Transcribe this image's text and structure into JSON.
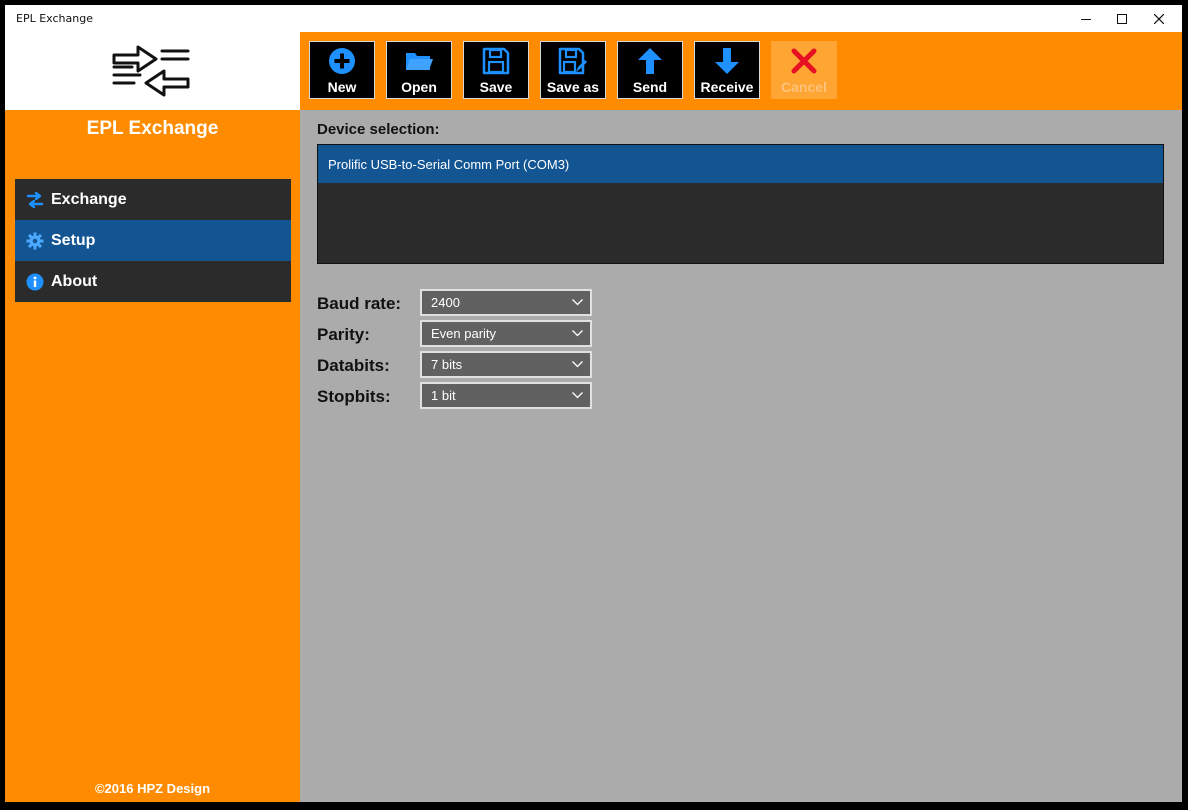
{
  "window": {
    "title": "EPL Exchange"
  },
  "sidebar": {
    "app_name": "EPL Exchange",
    "items": [
      {
        "label": "Exchange",
        "icon": "exchange-arrows-icon",
        "active": false
      },
      {
        "label": "Setup",
        "icon": "gear-icon",
        "active": true
      },
      {
        "label": "About",
        "icon": "info-icon",
        "active": false
      }
    ],
    "copyright": "©2016 HPZ Design"
  },
  "toolbar": {
    "new_label": "New",
    "open_label": "Open",
    "save_label": "Save",
    "save_as_label": "Save as",
    "send_label": "Send",
    "receive_label": "Receive",
    "cancel_label": "Cancel"
  },
  "main": {
    "device_selection_label": "Device selection:",
    "devices": [
      {
        "name": "Prolific USB-to-Serial Comm Port (COM3)",
        "selected": true
      }
    ],
    "settings": {
      "baud_rate_label": "Baud rate:",
      "baud_rate_value": "2400",
      "parity_label": "Parity:",
      "parity_value": "Even parity",
      "databits_label": "Databits:",
      "databits_value": "7 bits",
      "stopbits_label": "Stopbits:",
      "stopbits_value": "1 bit"
    }
  },
  "colors": {
    "accent_orange": "#ff8c00",
    "selected_blue": "#135593",
    "dark_panel": "#2b2b2b",
    "icon_blue": "#1e90ff",
    "cancel_red": "#e81123"
  }
}
